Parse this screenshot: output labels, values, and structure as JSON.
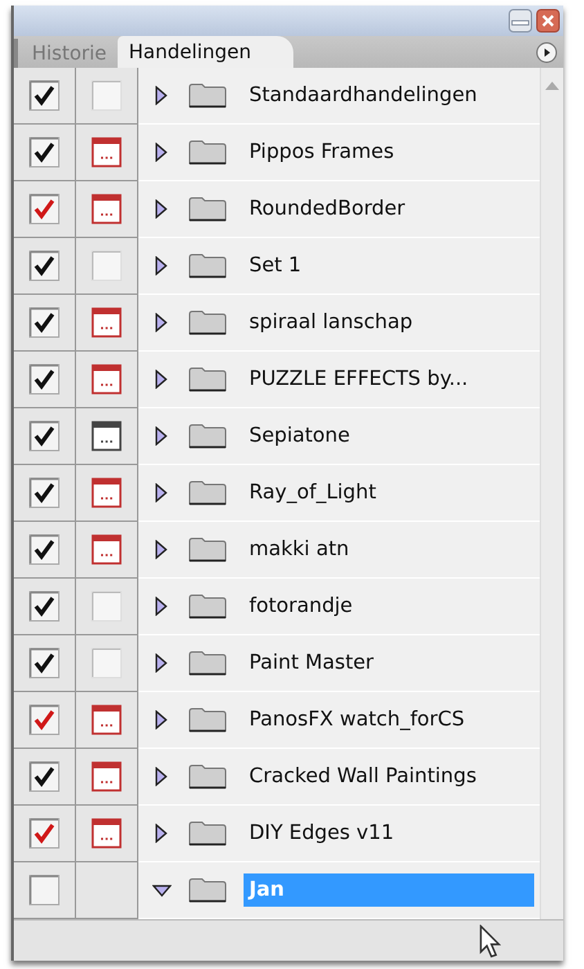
{
  "tabs": [
    {
      "label": "Historie",
      "selected": false
    },
    {
      "label": "Handelingen",
      "selected": true
    }
  ],
  "actions": [
    {
      "name": "Standaardhandelingen",
      "toggle": {
        "kind": "all"
      },
      "dialog": {
        "kind": "off"
      },
      "expanded": false,
      "selected": false
    },
    {
      "name": "Pippos Frames",
      "toggle": {
        "kind": "all"
      },
      "dialog": {
        "kind": "some"
      },
      "expanded": false,
      "selected": false
    },
    {
      "name": "RoundedBorder",
      "toggle": {
        "kind": "some"
      },
      "dialog": {
        "kind": "some"
      },
      "expanded": false,
      "selected": false
    },
    {
      "name": "Set 1",
      "toggle": {
        "kind": "all"
      },
      "dialog": {
        "kind": "off"
      },
      "expanded": false,
      "selected": false
    },
    {
      "name": "spiraal lanschap",
      "toggle": {
        "kind": "all"
      },
      "dialog": {
        "kind": "some"
      },
      "expanded": false,
      "selected": false
    },
    {
      "name": "PUZZLE EFFECTS by...",
      "toggle": {
        "kind": "all"
      },
      "dialog": {
        "kind": "some"
      },
      "expanded": false,
      "selected": false
    },
    {
      "name": "Sepiatone",
      "toggle": {
        "kind": "all"
      },
      "dialog": {
        "kind": "all"
      },
      "expanded": false,
      "selected": false
    },
    {
      "name": "Ray_of_Light",
      "toggle": {
        "kind": "all"
      },
      "dialog": {
        "kind": "some"
      },
      "expanded": false,
      "selected": false
    },
    {
      "name": "makki atn",
      "toggle": {
        "kind": "all"
      },
      "dialog": {
        "kind": "some"
      },
      "expanded": false,
      "selected": false
    },
    {
      "name": "fotorandje",
      "toggle": {
        "kind": "all"
      },
      "dialog": {
        "kind": "off"
      },
      "expanded": false,
      "selected": false
    },
    {
      "name": "Paint Master",
      "toggle": {
        "kind": "all"
      },
      "dialog": {
        "kind": "off"
      },
      "expanded": false,
      "selected": false
    },
    {
      "name": "PanosFX watch_forCS",
      "toggle": {
        "kind": "some"
      },
      "dialog": {
        "kind": "some"
      },
      "expanded": false,
      "selected": false
    },
    {
      "name": "Cracked Wall Paintings",
      "toggle": {
        "kind": "all"
      },
      "dialog": {
        "kind": "some"
      },
      "expanded": false,
      "selected": false
    },
    {
      "name": "DIY Edges v11",
      "toggle": {
        "kind": "some"
      },
      "dialog": {
        "kind": "some"
      },
      "expanded": false,
      "selected": false
    },
    {
      "name": "Jan",
      "toggle": {
        "kind": "off"
      },
      "dialog": {
        "kind": "hidden"
      },
      "expanded": true,
      "selected": true
    }
  ]
}
